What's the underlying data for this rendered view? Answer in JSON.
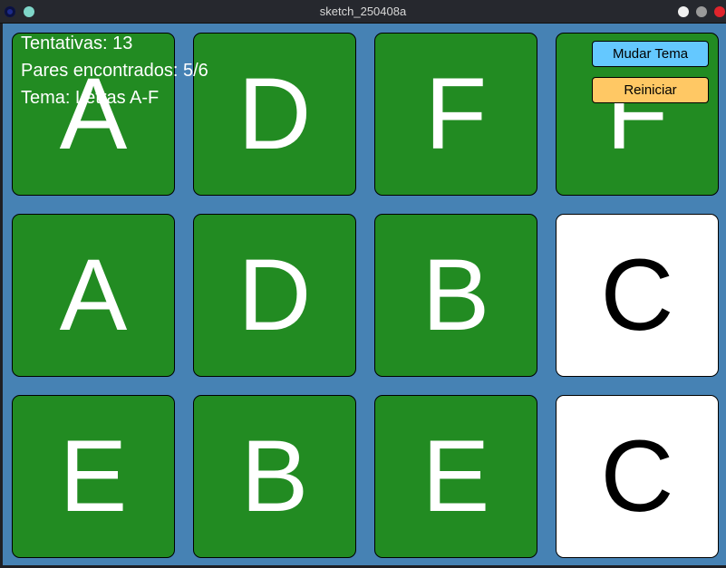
{
  "window": {
    "title": "sketch_250408a",
    "icons": [
      "app-icon",
      "sticky-icon",
      "minimize-icon",
      "maximize-icon",
      "close-icon"
    ]
  },
  "hud": {
    "attempts": "Tentativas: 13",
    "pairs": "Pares encontrados: 5/6",
    "theme": "Tema: Letras A-F"
  },
  "buttons": {
    "change_theme": "Mudar Tema",
    "restart": "Reiniciar"
  },
  "colors": {
    "background": "#4682b4",
    "card_back": "#228b22",
    "card_face": "#ffffff",
    "theme_button": "#64c8ff",
    "restart_button": "#ffc864"
  },
  "grid": {
    "rows": 3,
    "cols": 4,
    "cards": [
      {
        "symbol": "A",
        "state": "matched"
      },
      {
        "symbol": "D",
        "state": "matched"
      },
      {
        "symbol": "F",
        "state": "matched"
      },
      {
        "symbol": "F",
        "state": "matched"
      },
      {
        "symbol": "A",
        "state": "matched"
      },
      {
        "symbol": "D",
        "state": "matched"
      },
      {
        "symbol": "B",
        "state": "matched"
      },
      {
        "symbol": "C",
        "state": "revealed"
      },
      {
        "symbol": "E",
        "state": "matched"
      },
      {
        "symbol": "B",
        "state": "matched"
      },
      {
        "symbol": "E",
        "state": "matched"
      },
      {
        "symbol": "C",
        "state": "revealed"
      }
    ]
  }
}
